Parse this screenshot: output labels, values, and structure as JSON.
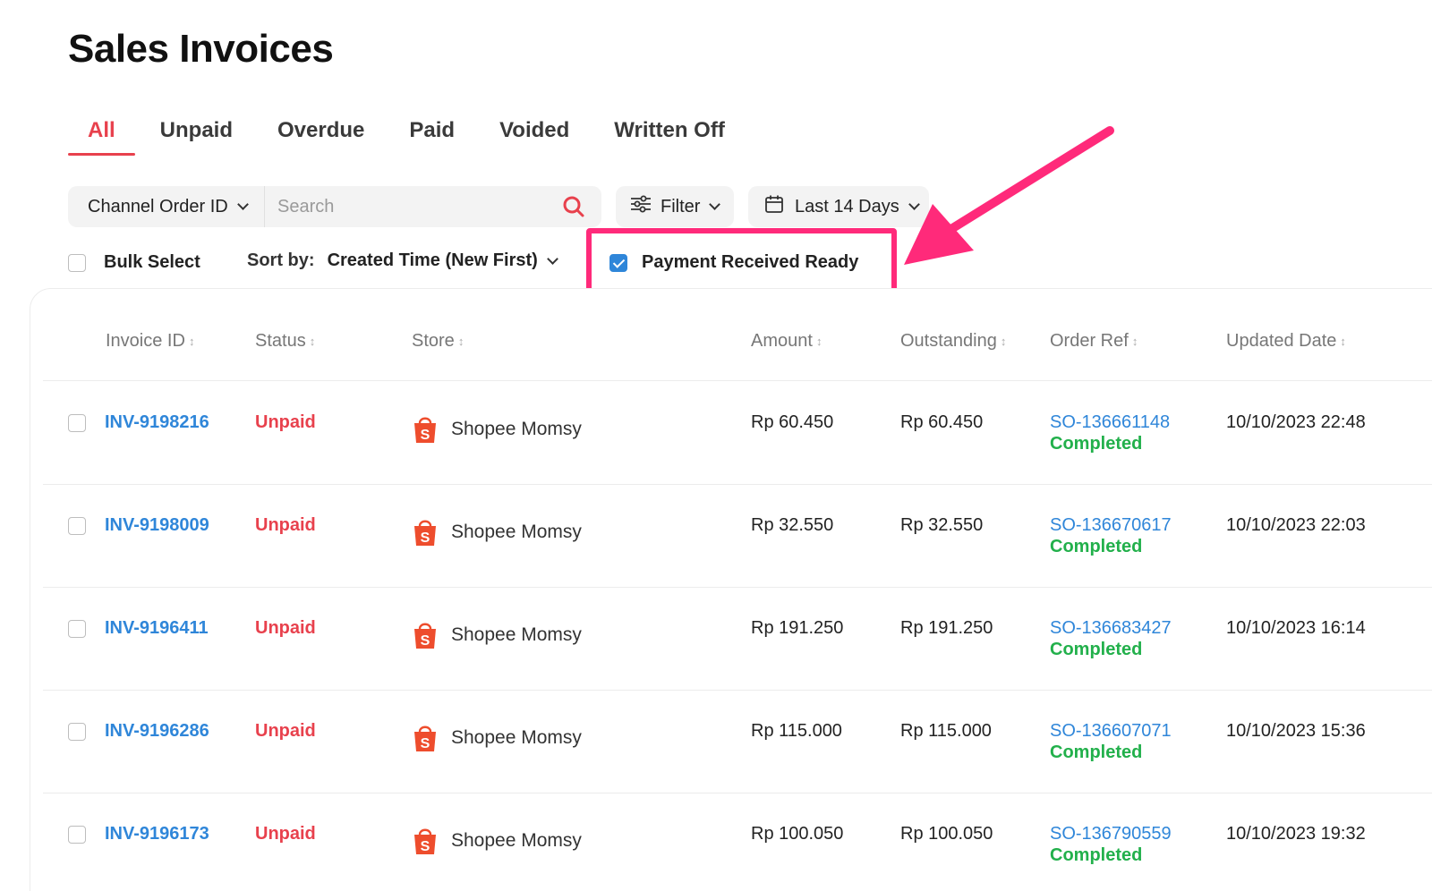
{
  "page": {
    "title": "Sales Invoices"
  },
  "tabs": [
    {
      "label": "All",
      "active": true
    },
    {
      "label": "Unpaid",
      "active": false
    },
    {
      "label": "Overdue",
      "active": false
    },
    {
      "label": "Paid",
      "active": false
    },
    {
      "label": "Voided",
      "active": false
    },
    {
      "label": "Written Off",
      "active": false
    }
  ],
  "search": {
    "field_select": "Channel Order ID",
    "placeholder": "Search",
    "value": ""
  },
  "filter": {
    "label": "Filter"
  },
  "date_range": {
    "label": "Last 14 Days"
  },
  "bulk_select": {
    "label": "Bulk Select",
    "checked": false
  },
  "sort": {
    "label": "Sort by:",
    "value": "Created Time (New First)"
  },
  "payment_received_ready": {
    "label": "Payment Received Ready",
    "checked": true
  },
  "colors": {
    "accent": "#e8414d",
    "link": "#2f86d9",
    "success": "#22b04b",
    "highlight": "#ff2a7a"
  },
  "table": {
    "columns": [
      "Invoice ID",
      "Status",
      "Store",
      "Amount",
      "Outstanding",
      "Order Ref",
      "Updated Date"
    ],
    "rows": [
      {
        "invoice_id": "INV-9198216",
        "status": "Unpaid",
        "store": "Shopee Momsy",
        "amount": "Rp 60.450",
        "outstanding": "Rp 60.450",
        "order_ref": "SO-136661148",
        "order_status": "Completed",
        "updated": "10/10/2023 22:48"
      },
      {
        "invoice_id": "INV-9198009",
        "status": "Unpaid",
        "store": "Shopee Momsy",
        "amount": "Rp 32.550",
        "outstanding": "Rp 32.550",
        "order_ref": "SO-136670617",
        "order_status": "Completed",
        "updated": "10/10/2023 22:03"
      },
      {
        "invoice_id": "INV-9196411",
        "status": "Unpaid",
        "store": "Shopee Momsy",
        "amount": "Rp 191.250",
        "outstanding": "Rp 191.250",
        "order_ref": "SO-136683427",
        "order_status": "Completed",
        "updated": "10/10/2023 16:14"
      },
      {
        "invoice_id": "INV-9196286",
        "status": "Unpaid",
        "store": "Shopee Momsy",
        "amount": "Rp 115.000",
        "outstanding": "Rp 115.000",
        "order_ref": "SO-136607071",
        "order_status": "Completed",
        "updated": "10/10/2023 15:36"
      },
      {
        "invoice_id": "INV-9196173",
        "status": "Unpaid",
        "store": "Shopee Momsy",
        "amount": "Rp 100.050",
        "outstanding": "Rp 100.050",
        "order_ref": "SO-136790559",
        "order_status": "Completed",
        "updated": "10/10/2023 19:32"
      }
    ]
  }
}
